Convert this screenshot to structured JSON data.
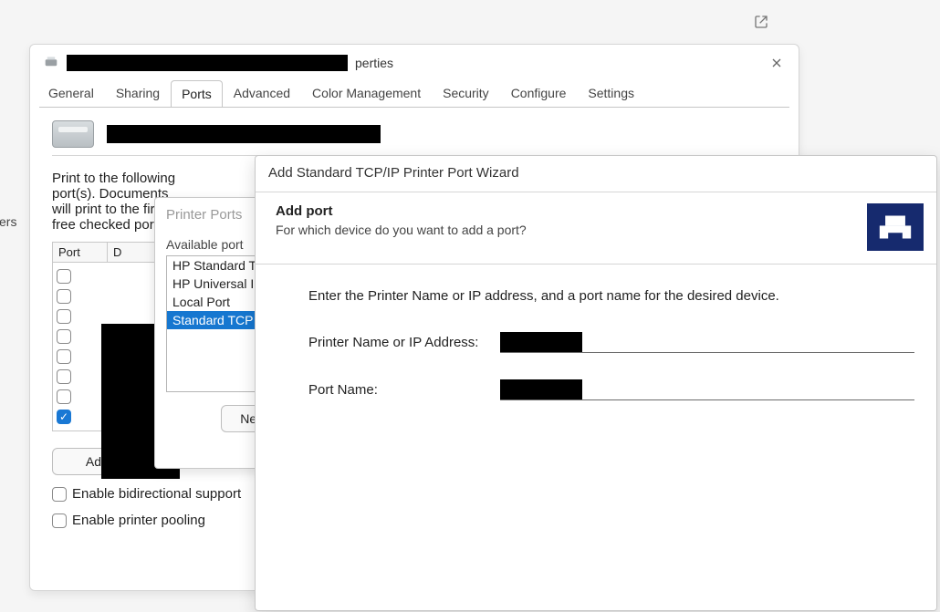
{
  "external_icon_name": "external-link-icon",
  "properties_window": {
    "title_suffix": "perties",
    "tabs": [
      "General",
      "Sharing",
      "Ports",
      "Advanced",
      "Color Management",
      "Security",
      "Configure",
      "Settings"
    ],
    "active_tab_index": 2,
    "instruction": "Print to the following port(s). Documents will print to the first free checked port.",
    "ports_header_port": "Port",
    "ports_header_desc": "D",
    "port_rows": [
      false,
      false,
      false,
      false,
      false,
      false,
      false,
      true
    ],
    "add_port_button": "Add Port...",
    "enable_bidir": "Enable bidirectional support",
    "enable_pooling": "Enable printer pooling"
  },
  "left_edge_text": "ers",
  "printer_ports_dialog": {
    "title": "Printer Ports",
    "available_label": "Available port",
    "items": [
      "HP Standard T",
      "HP Universal I",
      "Local Port",
      "Standard TCP"
    ],
    "selected_index": 3,
    "new_port_button": "New Port"
  },
  "wizard": {
    "title": "Add Standard TCP/IP Printer Port Wizard",
    "banner_heading": "Add port",
    "banner_sub": "For which device do you want to add a port?",
    "hint": "Enter the Printer Name or IP address, and a port name for the desired device.",
    "field1_label": "Printer Name or IP Address:",
    "field2_label": "Port Name:"
  }
}
